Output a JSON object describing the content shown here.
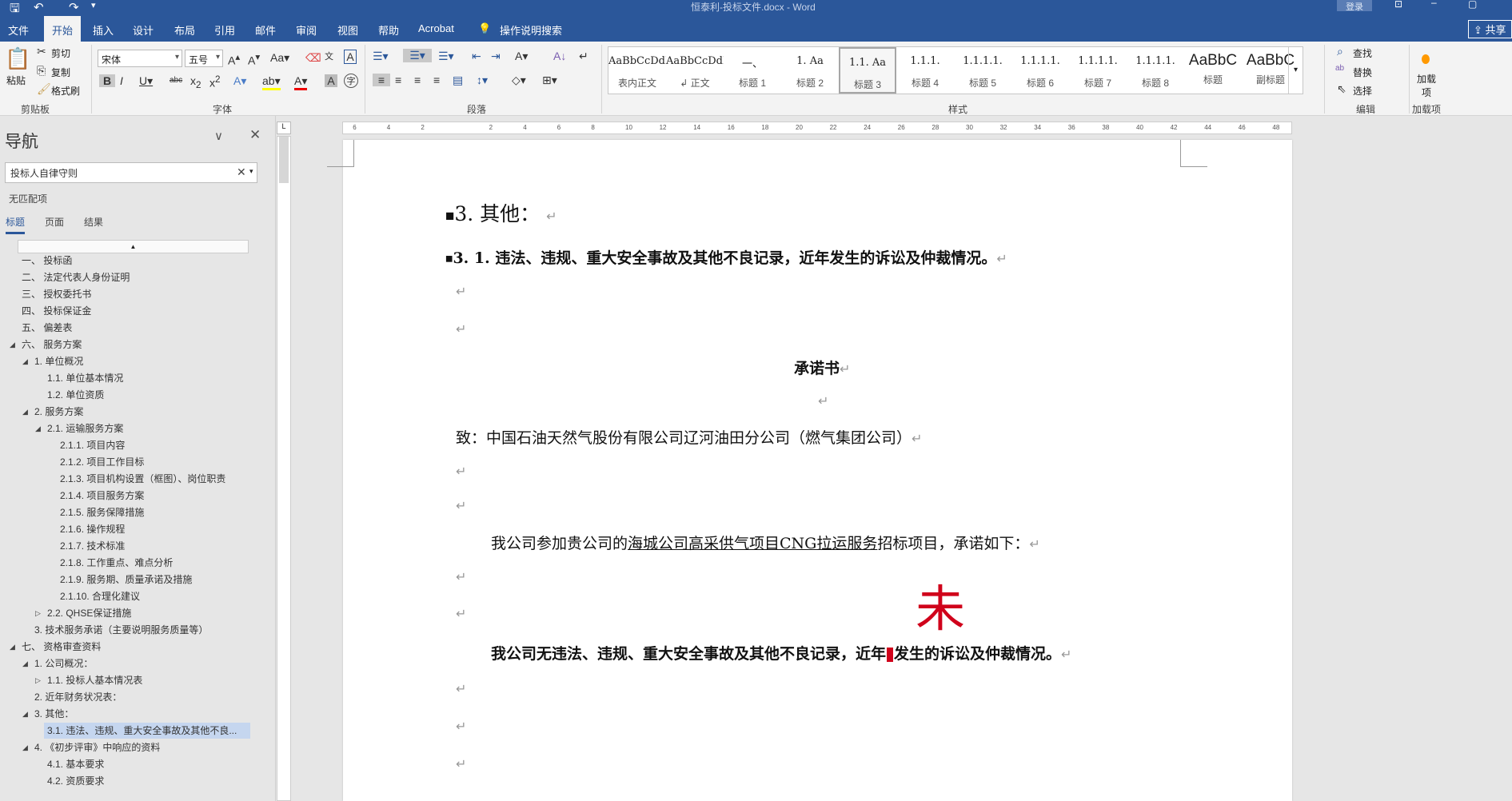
{
  "window": {
    "title": "恒泰利-投标文件.docx  -  Word",
    "login": "登录",
    "share": "共享"
  },
  "tabs": [
    "文件",
    "开始",
    "插入",
    "设计",
    "布局",
    "引用",
    "邮件",
    "审阅",
    "视图",
    "帮助",
    "Acrobat"
  ],
  "tell_me": "操作说明搜索",
  "ribbon": {
    "clipboard": {
      "paste": "粘贴",
      "cut": "剪切",
      "copy": "复制",
      "format_painter": "格式刷",
      "label": "剪贴板"
    },
    "font": {
      "font_name": "宋体",
      "font_size": "五号",
      "label": "字体"
    },
    "paragraph": {
      "label": "段落"
    },
    "styles": {
      "label": "样式",
      "items": [
        {
          "preview": "AaBbCcDdI",
          "name": "表内正文"
        },
        {
          "preview": "AaBbCcDdI",
          "name": "↲ 正文"
        },
        {
          "preview": "一、",
          "name": "标题 1"
        },
        {
          "preview": "1.   Aa",
          "name": "标题 2"
        },
        {
          "preview": "1.1.   Aa",
          "name": "标题 3",
          "selected": true
        },
        {
          "preview": "1.1.1.",
          "name": "标题 4"
        },
        {
          "preview": "1.1.1.1.",
          "name": "标题 5"
        },
        {
          "preview": "1.1.1.1.",
          "name": "标题 6"
        },
        {
          "preview": "1.1.1.1.",
          "name": "标题 7"
        },
        {
          "preview": "1.1.1.1.",
          "name": "标题 8"
        },
        {
          "preview": "AaBbC",
          "name": "标题"
        },
        {
          "preview": "AaBbC",
          "name": "副标题"
        }
      ]
    },
    "editing": {
      "find": "查找",
      "replace": "替换",
      "select": "选择",
      "label": "编辑"
    },
    "addins": {
      "button": "加载项",
      "label": "加载项"
    }
  },
  "nav": {
    "title": "导航",
    "search_value": "投标人自律守则",
    "no_match": "无匹配项",
    "tabs": [
      "标题",
      "页面",
      "结果"
    ],
    "items": [
      {
        "text": "一、  投标函",
        "level": 0
      },
      {
        "text": "二、  法定代表人身份证明",
        "level": 0
      },
      {
        "text": "三、  授权委托书",
        "level": 0
      },
      {
        "text": "四、  投标保证金",
        "level": 0
      },
      {
        "text": "五、  偏差表",
        "level": 0
      },
      {
        "text": "六、  服务方案",
        "level": 0,
        "toggle": "open"
      },
      {
        "text": "1. 单位概况",
        "level": 1,
        "toggle": "open"
      },
      {
        "text": "1.1. 单位基本情况",
        "level": 2
      },
      {
        "text": "1.2. 单位资质",
        "level": 2
      },
      {
        "text": "2. 服务方案",
        "level": 1,
        "toggle": "open"
      },
      {
        "text": "2.1. 运输服务方案",
        "level": 2,
        "toggle": "open"
      },
      {
        "text": "2.1.1. 项目内容",
        "level": 3
      },
      {
        "text": "2.1.2. 项目工作目标",
        "level": 3
      },
      {
        "text": "2.1.3. 项目机构设置（框图）、岗位职责",
        "level": 3
      },
      {
        "text": "2.1.4. 项目服务方案",
        "level": 3
      },
      {
        "text": "2.1.5. 服务保障措施",
        "level": 3
      },
      {
        "text": "2.1.6. 操作规程",
        "level": 3
      },
      {
        "text": "2.1.7. 技术标准",
        "level": 3
      },
      {
        "text": "2.1.8. 工作重点、难点分析",
        "level": 3
      },
      {
        "text": "2.1.9. 服务期、质量承诺及措施",
        "level": 3
      },
      {
        "text": "2.1.10. 合理化建议",
        "level": 3
      },
      {
        "text": "2.2. QHSE保证措施",
        "level": 2,
        "toggle": "closed"
      },
      {
        "text": "3. 技术服务承诺（主要说明服务质量等）",
        "level": 1
      },
      {
        "text": "七、  资格审查资料",
        "level": 0,
        "toggle": "open"
      },
      {
        "text": "1. 公司概况：",
        "level": 1,
        "toggle": "open"
      },
      {
        "text": "1.1. 投标人基本情况表",
        "level": 2,
        "toggle": "closed"
      },
      {
        "text": "2. 近年财务状况表：",
        "level": 1
      },
      {
        "text": "3. 其他：",
        "level": 1,
        "toggle": "open"
      },
      {
        "text": "3.1. 违法、违规、重大安全事故及其他不良...",
        "level": 2,
        "selected": true
      },
      {
        "text": "4. 《初步评审》中响应的资料",
        "level": 1,
        "toggle": "open"
      },
      {
        "text": "4.1. 基本要求",
        "level": 2
      },
      {
        "text": "4.2. 资质要求",
        "level": 2
      }
    ]
  },
  "document": {
    "heading3": "3. 其他：",
    "heading31": "3. 1. 违法、违规、重大安全事故及其他不良记录，近年发生的诉讼及仲裁情况。",
    "title": "承诺书",
    "to": "致：中国石油天然气股份有限公司辽河油田分公司（燃气集团公司）",
    "p1_pre": "我公司参加贵公司的",
    "p1_link": "海城公司高采供气项目CNG拉运服务",
    "p1_post": "招标项目，承诺如下：",
    "red_char": "未",
    "p2_pre": "我公司无违法、违规、重大安全事故及其他不良记录，近年",
    "p2_post": "发生的诉讼及仲裁情况。",
    "para_mark": "↵",
    "accent": "#2b579a",
    "red": "#d0021b"
  }
}
